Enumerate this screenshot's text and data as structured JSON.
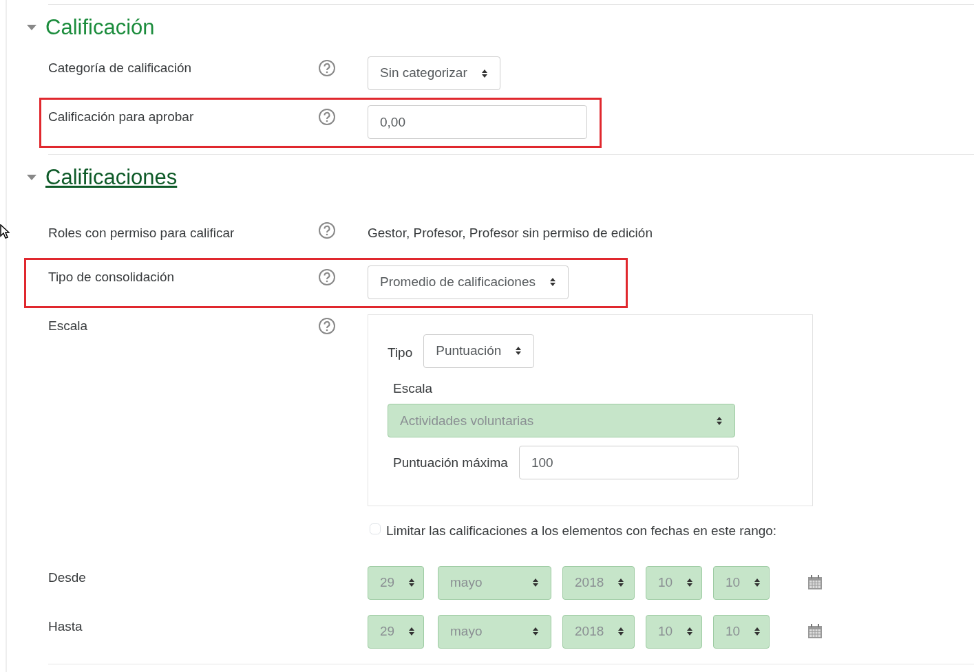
{
  "sections": [
    {
      "title": "Calificación",
      "expanded": true,
      "focused": false,
      "fields": [
        {
          "kind": "select",
          "label": "Categoría de calificación",
          "help": true,
          "value": "Sin categorizar",
          "highlighted": false
        },
        {
          "kind": "text",
          "label": "Calificación para aprobar",
          "help": true,
          "value": "0,00",
          "highlighted": true
        }
      ]
    },
    {
      "title": "Calificaciones",
      "expanded": true,
      "focused": true,
      "fields": [
        {
          "kind": "static",
          "label": "Roles con permiso para calificar",
          "help": true,
          "value": "Gestor, Profesor, Profesor sin permiso de edición",
          "highlighted": false
        },
        {
          "kind": "select",
          "label": "Tipo de consolidación",
          "help": true,
          "value": "Promedio de calificaciones",
          "highlighted": true
        },
        {
          "kind": "scale",
          "label": "Escala",
          "help": true,
          "type_label": "Tipo",
          "type_value": "Puntuación",
          "scale_label": "Escala",
          "scale_value": "Actividades voluntarias",
          "scale_disabled": true,
          "max_label": "Puntuación máxima",
          "max_value": "100",
          "highlighted": false
        },
        {
          "kind": "checkbox",
          "label": "Limitar las calificaciones a los elementos con fechas en este rango:",
          "checked": false,
          "highlighted": false
        },
        {
          "kind": "date",
          "label": "Desde",
          "disabled": true,
          "parts": [
            "29",
            "mayo",
            "2018",
            "10",
            "10"
          ],
          "highlighted": false
        },
        {
          "kind": "date",
          "label": "Hasta",
          "disabled": true,
          "parts": [
            "29",
            "mayo",
            "2018",
            "10",
            "10"
          ],
          "highlighted": false
        }
      ]
    }
  ]
}
